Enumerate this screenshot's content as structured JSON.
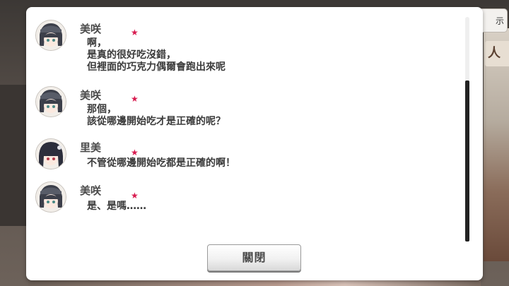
{
  "side_button_label": "示",
  "side_sign_text": "人精",
  "log": {
    "entries": [
      {
        "speaker": "美咲",
        "lines": [
          "啊，",
          "是真的很好吃沒錯，",
          "但裡面的巧克力偶爾會跑出來呢"
        ],
        "avatar": "misaki-avatar"
      },
      {
        "speaker": "美咲",
        "lines": [
          "那個，",
          "該從哪邊開始吃才是正確的呢？"
        ],
        "avatar": "misaki-avatar"
      },
      {
        "speaker": "里美",
        "lines": [
          "不管從哪邊開始吃都是正確的啊！"
        ],
        "avatar": "rimi-avatar"
      },
      {
        "speaker": "美咲",
        "lines": [
          "是、是嗎……"
        ],
        "avatar": "misaki-avatar"
      }
    ],
    "star_glyph": "★",
    "star_color": "#d81b4f"
  },
  "close_button_label": "關閉"
}
